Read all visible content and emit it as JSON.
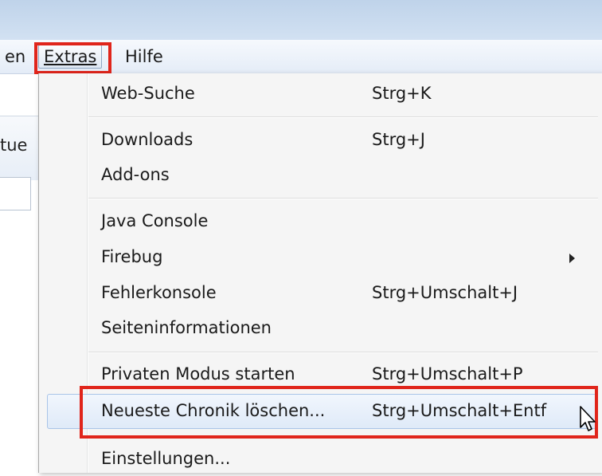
{
  "menubar": {
    "left_partial": "en",
    "extras": "Extras",
    "hilfe": "Hilfe"
  },
  "background": {
    "partial_text": "tue"
  },
  "extras_menu": {
    "items": [
      {
        "label": "Web-Suche",
        "shortcut": "Strg+K"
      },
      {
        "label": "Downloads",
        "shortcut": "Strg+J"
      },
      {
        "label": "Add-ons",
        "shortcut": ""
      },
      {
        "label": "Java Console",
        "shortcut": ""
      },
      {
        "label": "Firebug",
        "shortcut": "",
        "submenu": true
      },
      {
        "label": "Fehlerkonsole",
        "shortcut": "Strg+Umschalt+J"
      },
      {
        "label": "Seiteninformationen",
        "shortcut": ""
      },
      {
        "label": "Privaten Modus starten",
        "shortcut": "Strg+Umschalt+P"
      },
      {
        "label": "Neueste Chronik löschen...",
        "shortcut": "Strg+Umschalt+Entf",
        "hovered": true
      },
      {
        "label": "Einstellungen...",
        "shortcut": ""
      }
    ]
  },
  "colors": {
    "highlight_border": "#e0251b",
    "hover_background": "#dfeaf8",
    "menu_background": "#f5f5f5"
  },
  "icons": {
    "submenu_arrow": "chevron-right-icon",
    "cursor": "mouse-pointer-icon"
  }
}
